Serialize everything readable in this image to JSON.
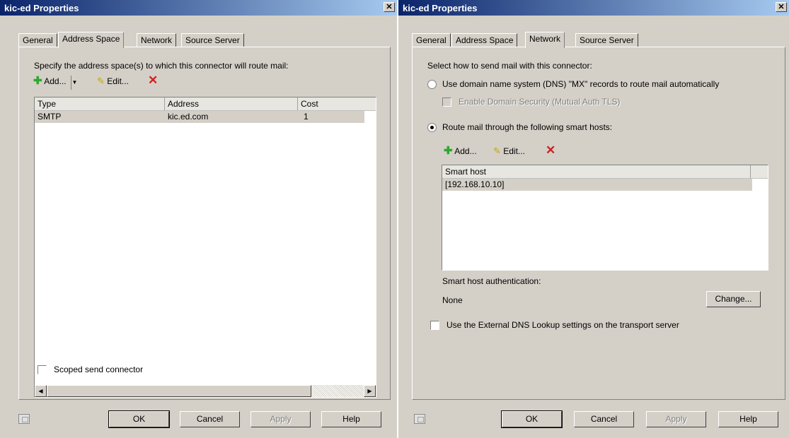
{
  "left": {
    "title": "kic-ed Properties",
    "close": "✕",
    "tabs": [
      "General",
      "Address Space",
      "Network",
      "Source Server"
    ],
    "instruction": "Specify the address space(s) to which this connector will route mail:",
    "toolbar": {
      "add": "Add...",
      "edit": "Edit..."
    },
    "columns": [
      "Type",
      "Address",
      "Cost"
    ],
    "rows": [
      {
        "type": "SMTP",
        "address": "kic.ed.com",
        "cost": "1"
      }
    ],
    "scoped": "Scoped send connector",
    "buttons": {
      "ok": "OK",
      "cancel": "Cancel",
      "apply": "Apply",
      "help": "Help"
    }
  },
  "right": {
    "title": "kic-ed Properties",
    "close": "✕",
    "tabs": [
      "General",
      "Address Space",
      "Network",
      "Source Server"
    ],
    "select_label": "Select how to send mail with this connector:",
    "dns_option": "Use domain name system (DNS) \"MX\" records to route mail automatically",
    "domain_security": "Enable Domain Security (Mutual Auth TLS)",
    "smart_host_option": "Route mail through the following smart hosts:",
    "toolbar": {
      "add": "Add...",
      "edit": "Edit..."
    },
    "columns": [
      "Smart host"
    ],
    "rows": [
      "[192.168.10.10]"
    ],
    "auth_label": "Smart host authentication:",
    "auth_value": "None",
    "change": "Change...",
    "external_dns": "Use the External DNS Lookup settings on the transport server",
    "buttons": {
      "ok": "OK",
      "cancel": "Cancel",
      "apply": "Apply",
      "help": "Help"
    }
  }
}
